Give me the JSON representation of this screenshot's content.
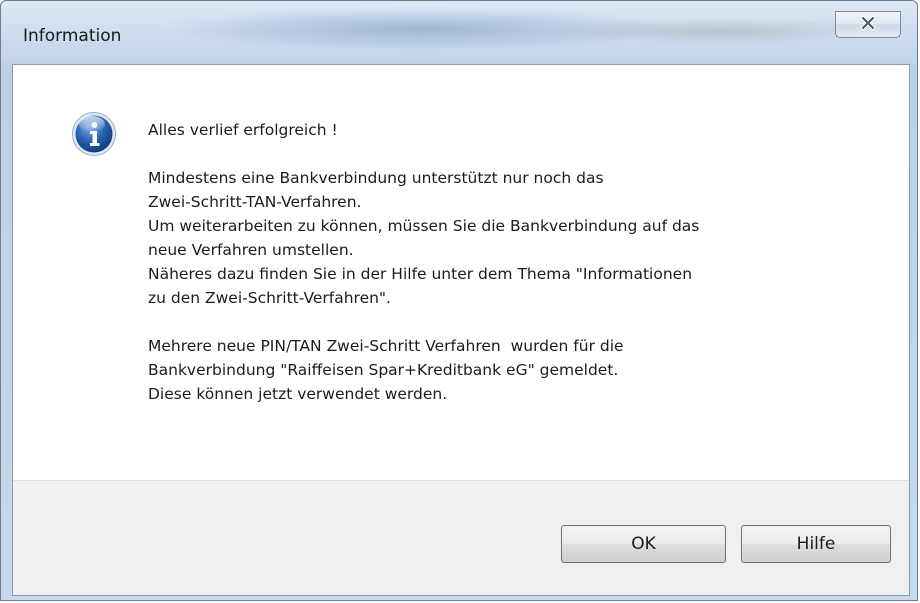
{
  "window": {
    "title": "Information"
  },
  "titlebar": {
    "close_icon": "close-x-icon"
  },
  "dialog": {
    "icon": "info-icon",
    "lines": [
      "Alles verlief erfolgreich !",
      "",
      "Mindestens eine Bankverbindung unterstützt nur noch das",
      "Zwei-Schritt-TAN-Verfahren.",
      "Um weiterarbeiten zu können, müssen Sie die Bankverbindung auf das",
      "neue Verfahren umstellen.",
      "Näheres dazu finden Sie in der Hilfe unter dem Thema \"Informationen",
      "zu den Zwei-Schritt-Verfahren\".",
      "",
      "Mehrere neue PIN/TAN Zwei-Schritt Verfahren  wurden für die",
      "Bankverbindung \"Raiffeisen Spar+Kreditbank eG\" gemeldet.",
      "Diese können jetzt verwendet werden."
    ]
  },
  "buttons": {
    "ok_label": "OK",
    "help_label": "Hilfe"
  },
  "colors": {
    "accent": "#2a62b0",
    "footer_bg": "#f0f0f0"
  }
}
